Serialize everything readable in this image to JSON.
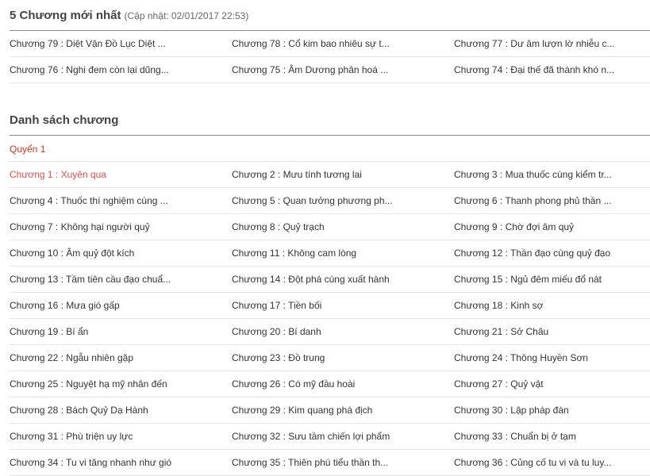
{
  "latest": {
    "title": "5 Chương mới nhất",
    "updated": "(Cập nhật: 02/01/2017 22:53)",
    "rows": [
      [
        "Chương 79 :  Diệt Vận Đồ Lục Diệt ...",
        "Chương 78 : Cổ kim bao nhiêu sự t...",
        "Chương 77 : Dư âm lượn lờ nhiễu c..."
      ],
      [
        "Chương 76 : Nghi đem còn lại dũng...",
        "Chương 75 : Âm Dương phân hoá ...",
        "Chương 74 : Đại thế đã thành khó n..."
      ]
    ]
  },
  "list": {
    "title": "Danh sách chương",
    "volume": "Quyển 1",
    "rows": [
      [
        "Chương 1 : Xuyên qua",
        "Chương 2 : Mưu tính tương lai",
        "Chương 3 : Mua thuốc cùng kiểm tr..."
      ],
      [
        "Chương 4 : Thuốc thí nghiệm cùng ...",
        "Chương 5 : Quan tưởng phương ph...",
        "Chương 6 : Thanh phong phủ thần ..."
      ],
      [
        "Chương 7 : Không hại người quỷ",
        "Chương 8 : Quỷ trạch",
        "Chương 9 : Chờ đợi âm quỷ"
      ],
      [
        "Chương 10 : Âm quỷ đột kích",
        "Chương 11 : Không cam lòng",
        "Chương 12 : Thần đạo cùng quỷ đạo"
      ],
      [
        "Chương 13 : Tầm tiên cầu đạo chuẩ...",
        "Chương 14 : Đột phá cùng xuất hành",
        "Chương 15 : Ngủ đêm miếu đổ nát"
      ],
      [
        "Chương 16 : Mưa gió gấp",
        "Chương 17 : Tiền bối",
        "Chương 18 : Kinh sợ"
      ],
      [
        "Chương 19 : Bí ẩn",
        "Chương 20 : Bí danh",
        "Chương 21 : Sở Châu"
      ],
      [
        "Chương 22 : Ngẫu nhiên gặp",
        "Chương 23 : Đồ trung",
        "Chương 24 : Thông Huyền Sơn"
      ],
      [
        "Chương 25 : Nguyệt hạ mỹ nhân đến",
        "Chương 26 : Có mỹ đầu hoài",
        "Chương 27 : Quỷ vật"
      ],
      [
        "Chương 28 : Bách Quỷ Dạ Hành",
        "Chương 29 : Kim quang phá địch",
        "Chương 30 : Lập pháp đàn"
      ],
      [
        "Chương 31 : Phù triện uy lực",
        "Chương 32 : Sưu tầm chiến lợi phẩm",
        "Chương 33 : Chuẩn bị ở tạm"
      ],
      [
        "Chương 34 : Tu vi tăng nhanh như gió",
        "Chương 35 : Thiên phú tiểu thần th...",
        "Chương 36 : Củng cố tu vi và tu luy..."
      ]
    ]
  },
  "colors": {
    "active_link": "#d9534f",
    "volume_label": "#c0392b"
  }
}
